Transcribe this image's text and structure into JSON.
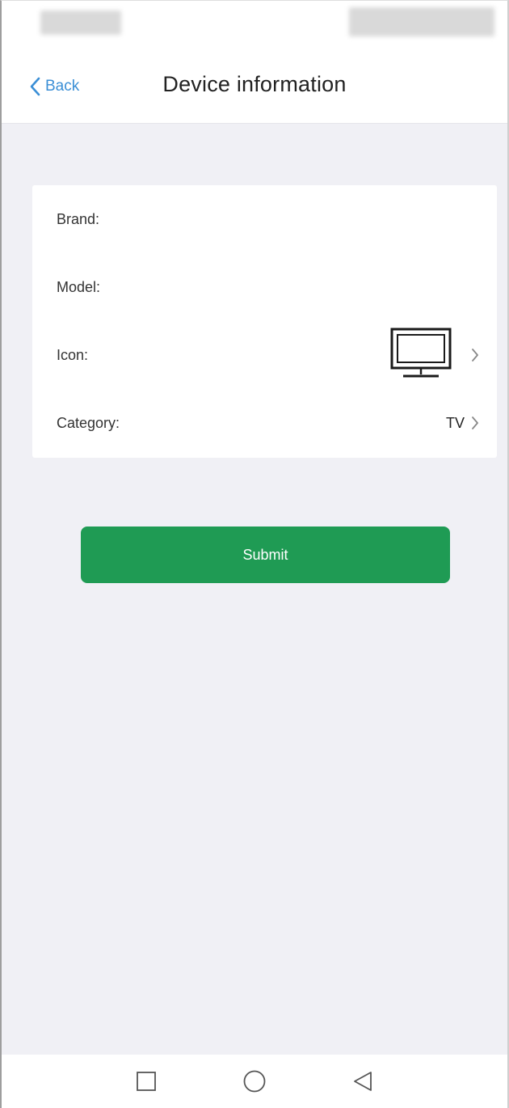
{
  "header": {
    "back_label": "Back",
    "title": "Device information"
  },
  "form": {
    "rows": [
      {
        "label": "Brand:",
        "value": ""
      },
      {
        "label": "Model:",
        "value": ""
      },
      {
        "label": "Icon:",
        "value": "",
        "icon": "tv-icon"
      },
      {
        "label": "Category:",
        "value": "TV"
      }
    ]
  },
  "submit_label": "Submit",
  "system_nav": {
    "icons": [
      "recents-square-icon",
      "home-circle-icon",
      "back-triangle-icon"
    ]
  },
  "colors": {
    "accent_blue": "#3b8fd6",
    "submit_green": "#1f9b54",
    "background": "#f0f0f5"
  }
}
